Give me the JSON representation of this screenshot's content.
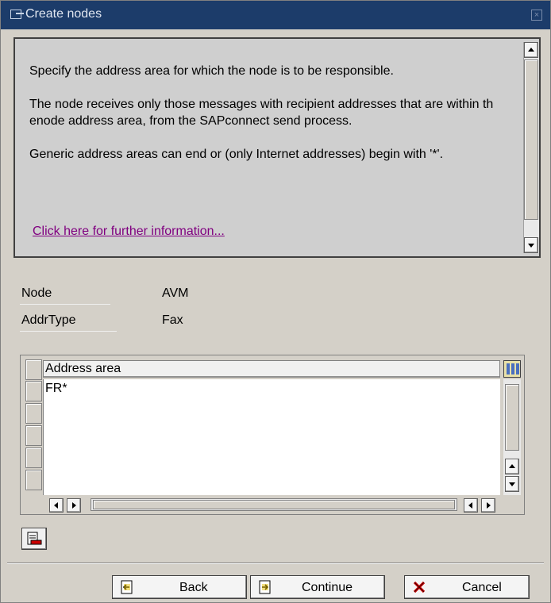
{
  "window": {
    "title": "Create nodes"
  },
  "info": {
    "paragraphs": [
      "Specify the address area for which the node is to be responsible.",
      "The node receives only those messages with recipient addresses that are within th enode address area, from the SAPconnect send process.",
      "Generic address areas can end or (only Internet addresses) begin with '*'."
    ],
    "link": "Click here for further information..."
  },
  "fields": {
    "node_label": "Node",
    "node_value": "AVM",
    "addrtype_label": "AddrType",
    "addrtype_value": "Fax"
  },
  "table": {
    "column_header": "Address area",
    "rows": [
      "FR*",
      "",
      "",
      "",
      "",
      ""
    ]
  },
  "buttons": {
    "back": "Back",
    "continue": "Continue",
    "cancel": "Cancel"
  },
  "colors": {
    "titlebar": "#1c3c6a",
    "link": "#800080",
    "cancel_icon": "#cc0000"
  },
  "icons": {
    "title": "window-icon",
    "close": "close-icon",
    "table_config": "table-settings-icon",
    "delete_row": "delete-row-icon",
    "back": "back-arrow-icon",
    "continue": "continue-arrow-icon",
    "cancel": "cancel-x-icon"
  }
}
